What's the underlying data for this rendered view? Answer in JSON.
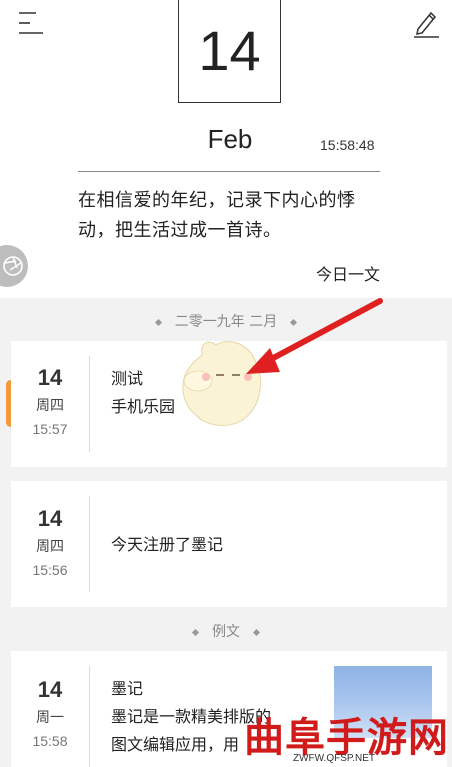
{
  "header": {
    "day": "14",
    "month": "Feb",
    "time": "15:58:48",
    "quote": "在相信爱的年纪，记录下内心的悸动，把生活过成一首诗。",
    "quote_source": "今日一文"
  },
  "sections": [
    {
      "label": "二零一九年 二月"
    },
    {
      "label": "例文"
    }
  ],
  "entries": [
    {
      "day": "14",
      "weekday": "周四",
      "time": "15:57",
      "lines": [
        "测试",
        "手机乐园"
      ]
    },
    {
      "day": "14",
      "weekday": "周四",
      "time": "15:56",
      "lines": [
        "今天注册了墨记"
      ]
    },
    {
      "day": "14",
      "weekday": "周一",
      "time": "15:58",
      "lines": [
        "墨记",
        "墨记是一款精美排版的",
        "图文编辑应用，用"
      ]
    }
  ],
  "watermark": {
    "title": "曲阜手游网",
    "url": "ZWFW.QFSP.NET"
  },
  "colors": {
    "accent_mark": "#f39a3c",
    "watermark_red": "#d11a1a",
    "arrow_red": "#e02020"
  },
  "icons": [
    "menu-icon",
    "edit-icon",
    "aperture-icon",
    "arrow-icon"
  ]
}
